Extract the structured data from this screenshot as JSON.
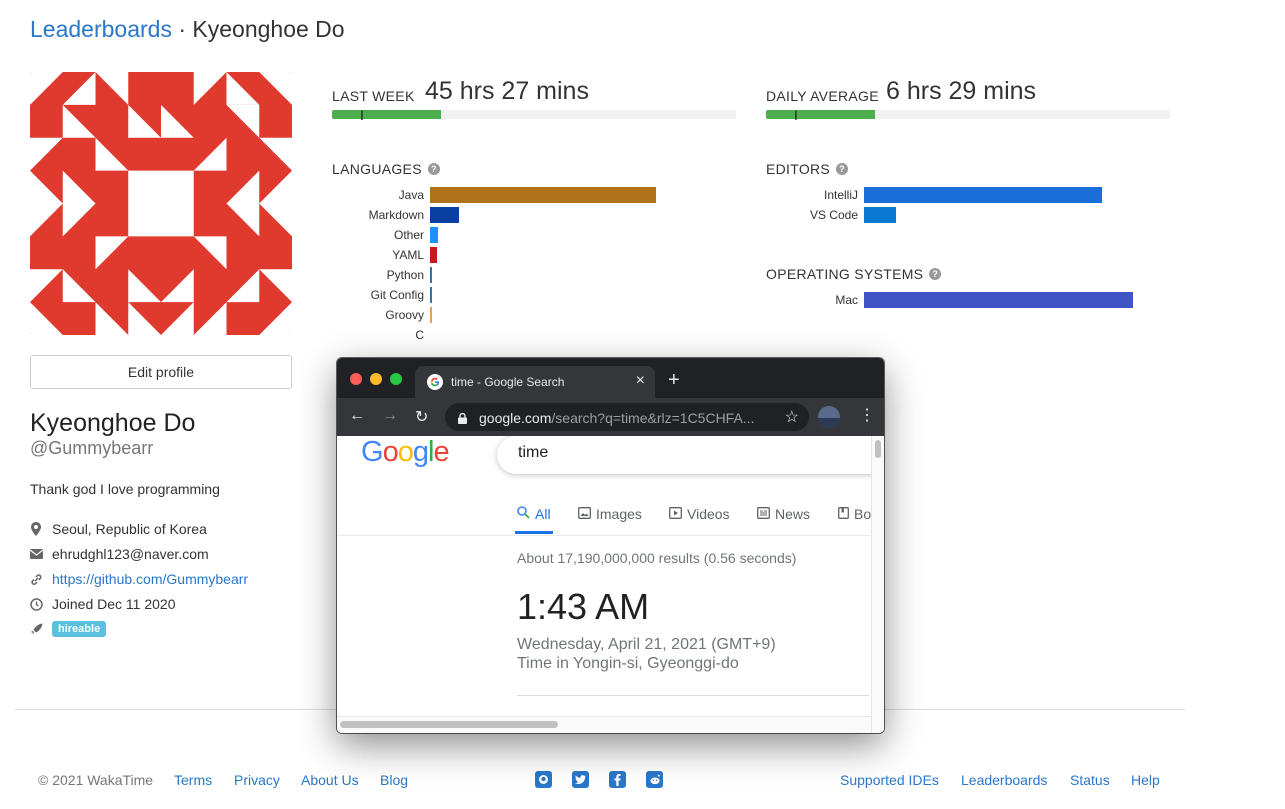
{
  "header": {
    "breadcrumb_link": "Leaderboards",
    "separator": " · ",
    "name": "Kyeonghoe Do"
  },
  "profile": {
    "edit_label": "Edit profile",
    "full_name": "Kyeonghoe Do",
    "username": "@Gummybearr",
    "bio": "Thank god I love programming",
    "location": "Seoul, Republic of Korea",
    "email": "ehrudghl123@naver.com",
    "website": "https://github.com/Gummybearr",
    "joined": "Joined Dec 11 2020",
    "badge": "hireable",
    "avatar_color": "#e03a2f"
  },
  "stats": {
    "last_week_label": "LAST WEEK",
    "last_week_value": "45 hrs 27 mins",
    "last_week_progress": 0.27,
    "daily_avg_label": "DAILY AVERAGE",
    "daily_avg_value": "6 hrs 29 mins",
    "daily_avg_progress": 0.27
  },
  "languages": {
    "title": "LANGUAGES",
    "items": [
      {
        "name": "Java",
        "value": 226,
        "color": "#b07219"
      },
      {
        "name": "Markdown",
        "value": 29,
        "color": "#083fa1"
      },
      {
        "name": "Other",
        "value": 8,
        "color": "#1e90ff"
      },
      {
        "name": "YAML",
        "value": 7,
        "color": "#cb171e"
      },
      {
        "name": "Python",
        "value": 1,
        "color": "#3572a5"
      },
      {
        "name": "Git Config",
        "value": 1,
        "color": "#3572a5"
      },
      {
        "name": "Groovy",
        "value": 1,
        "color": "#e69f56"
      },
      {
        "name": "C",
        "value": 0,
        "color": "#555555"
      }
    ]
  },
  "editors": {
    "title": "EDITORS",
    "items": [
      {
        "name": "IntelliJ",
        "value": 238,
        "color": "#1a6ed8"
      },
      {
        "name": "VS Code",
        "value": 32,
        "color": "#0c7ad3"
      }
    ]
  },
  "os": {
    "title": "OPERATING SYSTEMS",
    "items": [
      {
        "name": "Mac",
        "value": 269,
        "color": "#4054c6"
      }
    ]
  },
  "footer": {
    "copyright": "© 2021 WakaTime",
    "links_left": [
      "Terms",
      "Privacy",
      "About Us",
      "Blog"
    ],
    "links_right": [
      "Supported IDEs",
      "Leaderboards",
      "Status",
      "Help"
    ]
  },
  "browser": {
    "tab_title": "time - Google Search",
    "url_host": "google.com",
    "url_rest": "/search?q=time&rlz=1C5CHFA...",
    "search_query": "time",
    "tabs": [
      "All",
      "Images",
      "Videos",
      "News",
      "Bo"
    ],
    "results": "About 17,190,000,000 results (0.56 seconds)",
    "time": "1:43 AM",
    "date": "Wednesday, April 21, 2021 (GMT+9)",
    "place": "Time in Yongin-si, Gyeonggi-do"
  }
}
